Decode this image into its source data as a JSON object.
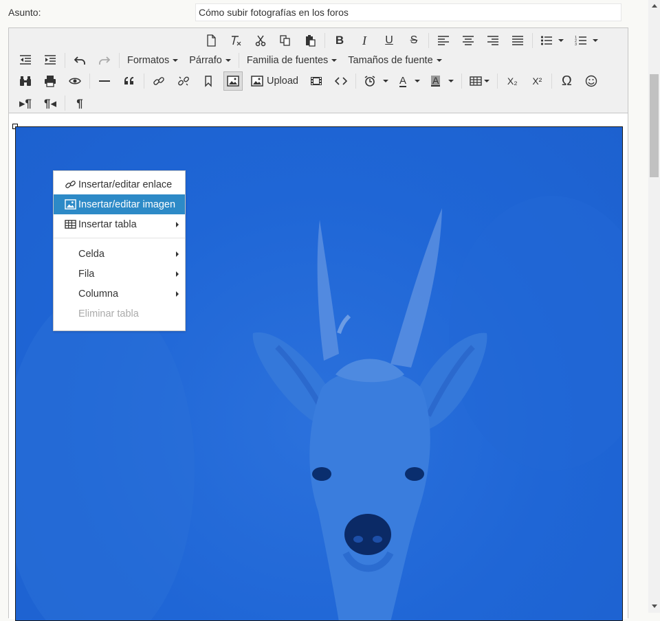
{
  "subject": {
    "label": "Asunto:",
    "value": "Cómo subir fotografías en los foros"
  },
  "toolbar": {
    "formats_label": "Formatos",
    "paragraph_label": "Párrafo",
    "font_family_label": "Familia de fuentes",
    "font_size_label": "Tamaños de fuente",
    "upload_label": "Upload",
    "text_color_letter": "A",
    "bg_color_letter": "A",
    "subscript_glyph": "X₂",
    "superscript_glyph": "X²",
    "omega_glyph": "Ω",
    "pilcrow_glyph": "¶",
    "quote_glyph": "66"
  },
  "context_menu": {
    "items": [
      {
        "label": "Insertar/editar enlace",
        "icon": "link-icon"
      },
      {
        "label": "Insertar/editar imagen",
        "icon": "image-icon",
        "selected": true
      },
      {
        "label": "Insertar tabla",
        "icon": "table-icon",
        "submenu": true
      },
      {
        "label": "Celda",
        "submenu": true
      },
      {
        "label": "Fila",
        "submenu": true
      },
      {
        "label": "Columna",
        "submenu": true
      },
      {
        "label": "Eliminar tabla",
        "disabled": true
      }
    ]
  },
  "colors": {
    "selection": "#2d8ac7",
    "photo_tint": "#1f66d6",
    "toolbar_bg": "#f0f0f0"
  }
}
